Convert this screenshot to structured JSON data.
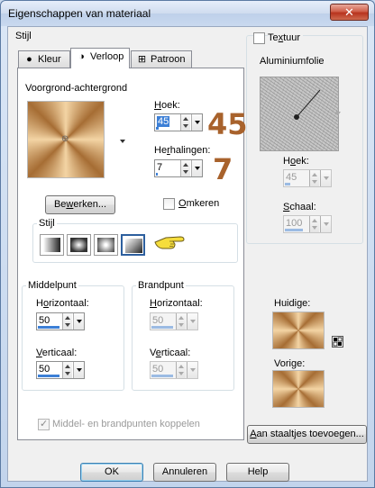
{
  "window": {
    "title": "Eigenschappen van materiaal",
    "close_glyph": "✕"
  },
  "stijl_label": "Stijl",
  "tabs": [
    {
      "label": "Kleur",
      "icon": "circle-icon"
    },
    {
      "label": "Verloop",
      "icon": "half-circle-icon"
    },
    {
      "label": "Patroon",
      "icon": "pattern-icon"
    }
  ],
  "gradient": {
    "name": "Voorgrond-achtergrond",
    "angle_label": "Hoek:",
    "angle_value": "45",
    "angle_annotation": "45",
    "angle_fraction": 0.125,
    "repeats_label": "Herhalingen:",
    "repeats_value": "7",
    "repeats_annotation": "7",
    "repeats_fraction": 0.07,
    "edit_button": "Bewerken...",
    "invert_label": "Omkeren",
    "invert_checked": false,
    "style_group_label": "Stijl",
    "style_buttons": [
      "linear-gradient-style",
      "rectangular-gradient-style",
      "sunburst-gradient-style",
      "radial-gradient-style"
    ],
    "selected_style": 3
  },
  "center_point": {
    "label": "Middelpunt",
    "horizontal_label": "Horizontaal:",
    "horizontal_value": "50",
    "vertical_label": "Verticaal:",
    "vertical_value": "50"
  },
  "focal_point": {
    "label": "Brandpunt",
    "horizontal_label": "Horizontaal:",
    "horizontal_value": "50",
    "vertical_label": "Verticaal:",
    "vertical_value": "50"
  },
  "link_points_label": "Middel- en brandpunten koppelen",
  "link_points_checked": true,
  "texture": {
    "label": "Textuur",
    "checked": false,
    "name": "Aluminiumfolie",
    "angle_label": "Hoek:",
    "angle_value": "45",
    "scale_label": "Schaal:",
    "scale_value": "100"
  },
  "current_label": "Huidige:",
  "previous_label": "Vorige:",
  "add_to_swatches_button": "Aan staaltjes toevoegen...",
  "buttons": {
    "ok": "OK",
    "cancel": "Annuleren",
    "help": "Help"
  },
  "colors": {
    "accent": "#3c7fd6",
    "annotation": "#a8622c",
    "gradient_light": "#f3d4a4",
    "gradient_dark": "#a66d34"
  }
}
